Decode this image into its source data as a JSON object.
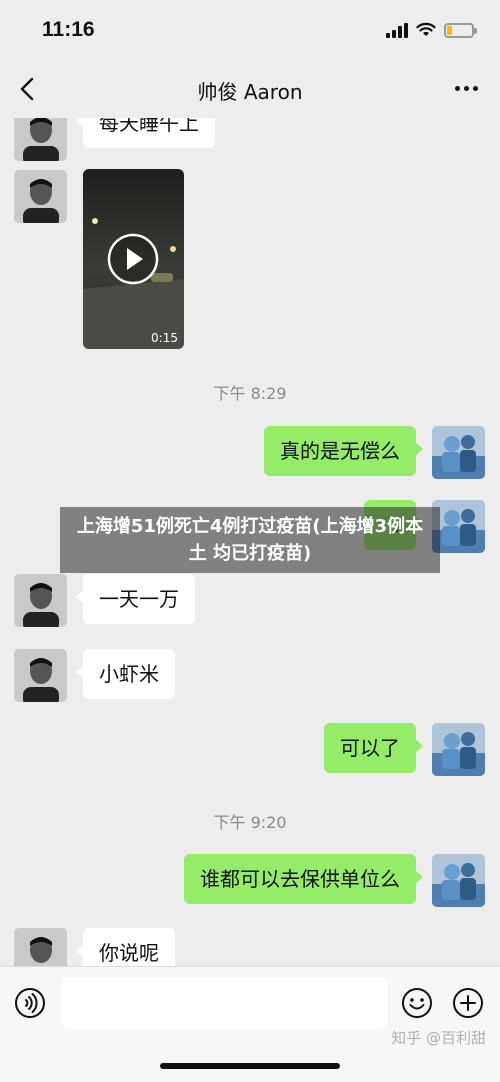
{
  "status_bar": {
    "time": "11:16",
    "battery_level": 0.22,
    "battery_color": "#f2c200"
  },
  "nav": {
    "title": "帅俊 Aaron",
    "back_icon": "chevron-left-icon",
    "more_icon": "more-dots-icon"
  },
  "messages": [
    {
      "side": "left",
      "text": "每天睡午上",
      "partial": true
    },
    {
      "side": "left",
      "type": "video",
      "duration": "0:15"
    },
    {
      "type": "time",
      "text": "下午 8:29"
    },
    {
      "side": "right",
      "text": "真的是无偿么"
    },
    {
      "side": "right",
      "text": "…"
    },
    {
      "side": "left",
      "text": "一天一万"
    },
    {
      "side": "left",
      "text": "小虾米"
    },
    {
      "side": "right",
      "text": "可以了"
    },
    {
      "type": "time",
      "text": "下午 9:20"
    },
    {
      "side": "right",
      "text": "谁都可以去保供单位么"
    },
    {
      "side": "left",
      "text": "你说呢"
    }
  ],
  "overlay": {
    "text": "上海增51例死亡4例打过疫苗(上海增3例本土 均已打疫苗)"
  },
  "input_bar": {
    "placeholder": "",
    "voice_icon": "voice-icon",
    "emoji_icon": "emoji-icon",
    "plus_icon": "plus-icon"
  },
  "watermark": {
    "text": "知乎 @百利甜"
  },
  "colors": {
    "background": "#ededed",
    "bubble_self": "#95ec69",
    "bubble_other": "#ffffff"
  }
}
